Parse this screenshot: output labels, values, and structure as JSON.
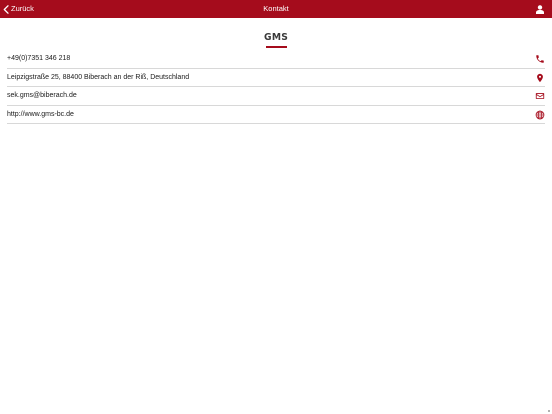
{
  "navbar": {
    "back_label": "Zurück",
    "title": "Kontakt",
    "background": "#a50c1c",
    "back_icon": "chevron-left-icon",
    "user_icon": "user-icon"
  },
  "logo": {
    "text": "GMS",
    "accent": "#a50c1c"
  },
  "contact": {
    "items": [
      {
        "value": "+49(0)7351 346 218",
        "icon": "phone-icon"
      },
      {
        "value": "Leipzigstraße 25, 88400 Biberach an der Riß, Deutschland",
        "icon": "location-pin-icon"
      },
      {
        "value": "sek.gms@biberach.de",
        "icon": "envelope-icon"
      },
      {
        "value": "http://www.gms-bc.de",
        "icon": "globe-icon"
      }
    ]
  }
}
